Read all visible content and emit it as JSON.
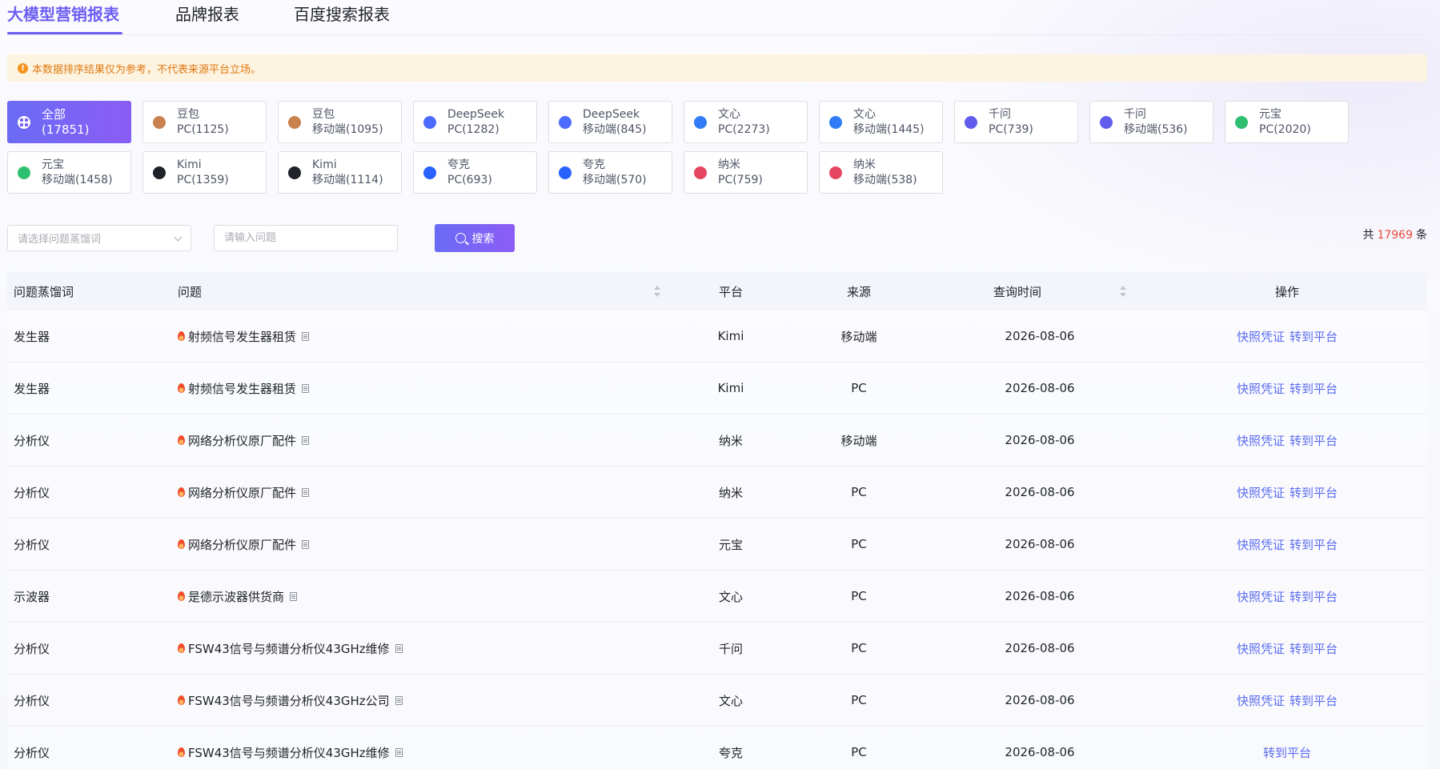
{
  "tabs": [
    {
      "label": "大模型营销报表",
      "active": true
    },
    {
      "label": "品牌报表",
      "active": false
    },
    {
      "label": "百度搜索报表",
      "active": false
    }
  ],
  "notice": "本数据排序结果仅为参考，不代表来源平台立场。",
  "chips": [
    {
      "line1": "全部",
      "line2": "(17851)",
      "icon": "grid-icon",
      "color": "#7a63f4",
      "active": true
    },
    {
      "line1": "豆包",
      "line2": "PC(1125)",
      "icon": "doubao-icon",
      "color": "#c9824f"
    },
    {
      "line1": "豆包",
      "line2": "移动端(1095)",
      "icon": "doubao-icon",
      "color": "#c9824f"
    },
    {
      "line1": "DeepSeek",
      "line2": "PC(1282)",
      "icon": "deepseek-icon",
      "color": "#4d6bfe"
    },
    {
      "line1": "DeepSeek",
      "line2": "移动端(845)",
      "icon": "deepseek-icon",
      "color": "#4d6bfe"
    },
    {
      "line1": "文心",
      "line2": "PC(2273)",
      "icon": "wenxin-icon",
      "color": "#2f7cf6"
    },
    {
      "line1": "文心",
      "line2": "移动端(1445)",
      "icon": "wenxin-icon",
      "color": "#2f7cf6"
    },
    {
      "line1": "千问",
      "line2": "PC(739)",
      "icon": "qianwen-icon",
      "color": "#615ced"
    },
    {
      "line1": "千问",
      "line2": "移动端(536)",
      "icon": "qianwen-icon",
      "color": "#615ced"
    },
    {
      "line1": "元宝",
      "line2": "PC(2020)",
      "icon": "yuanbao-icon",
      "color": "#2fbf71"
    },
    {
      "line1": "元宝",
      "line2": "移动端(1458)",
      "icon": "yuanbao-icon",
      "color": "#2fbf71"
    },
    {
      "line1": "Kimi",
      "line2": "PC(1359)",
      "icon": "kimi-icon",
      "color": "#1f2329"
    },
    {
      "line1": "Kimi",
      "line2": "移动端(1114)",
      "icon": "kimi-icon",
      "color": "#1f2329"
    },
    {
      "line1": "夸克",
      "line2": "PC(693)",
      "icon": "quark-icon",
      "color": "#2962ff"
    },
    {
      "line1": "夸克",
      "line2": "移动端(570)",
      "icon": "quark-icon",
      "color": "#2962ff"
    },
    {
      "line1": "纳米",
      "line2": "PC(759)",
      "icon": "nami-icon",
      "color": "#e64560"
    },
    {
      "line1": "纳米",
      "line2": "移动端(538)",
      "icon": "nami-icon",
      "color": "#e64560"
    }
  ],
  "search": {
    "select_placeholder": "请选择问题蒸馏词",
    "input_placeholder": "请输入问题",
    "button_label": "搜索"
  },
  "total": {
    "prefix": "共",
    "count": "17969",
    "suffix": "条"
  },
  "table": {
    "headers": {
      "keyword": "问题蒸馏词",
      "question": "问题",
      "platform": "平台",
      "source": "来源",
      "time": "查询时间",
      "ops": "操作"
    },
    "rows": [
      {
        "keyword": "发生器",
        "question": "射频信号发生器租赁",
        "platform": "Kimi",
        "source": "移动端",
        "time": "2026-08-06",
        "ops": [
          "快照凭证",
          "转到平台"
        ]
      },
      {
        "keyword": "发生器",
        "question": "射频信号发生器租赁",
        "platform": "Kimi",
        "source": "PC",
        "time": "2026-08-06",
        "ops": [
          "快照凭证",
          "转到平台"
        ]
      },
      {
        "keyword": "分析仪",
        "question": "网络分析仪原厂配件",
        "platform": "纳米",
        "source": "移动端",
        "time": "2026-08-06",
        "ops": [
          "快照凭证",
          "转到平台"
        ]
      },
      {
        "keyword": "分析仪",
        "question": "网络分析仪原厂配件",
        "platform": "纳米",
        "source": "PC",
        "time": "2026-08-06",
        "ops": [
          "快照凭证",
          "转到平台"
        ]
      },
      {
        "keyword": "分析仪",
        "question": "网络分析仪原厂配件",
        "platform": "元宝",
        "source": "PC",
        "time": "2026-08-06",
        "ops": [
          "快照凭证",
          "转到平台"
        ]
      },
      {
        "keyword": "示波器",
        "question": "是德示波器供货商",
        "platform": "文心",
        "source": "PC",
        "time": "2026-08-06",
        "ops": [
          "快照凭证",
          "转到平台"
        ]
      },
      {
        "keyword": "分析仪",
        "question": "FSW43信号与频谱分析仪43GHz维修",
        "platform": "千问",
        "source": "PC",
        "time": "2026-08-06",
        "ops": [
          "快照凭证",
          "转到平台"
        ]
      },
      {
        "keyword": "分析仪",
        "question": "FSW43信号与频谱分析仪43GHz公司",
        "platform": "文心",
        "source": "PC",
        "time": "2026-08-06",
        "ops": [
          "快照凭证",
          "转到平台"
        ]
      },
      {
        "keyword": "分析仪",
        "question": "FSW43信号与频谱分析仪43GHz维修",
        "platform": "夸克",
        "source": "PC",
        "time": "2026-08-06",
        "ops": [
          "转到平台"
        ]
      }
    ]
  }
}
